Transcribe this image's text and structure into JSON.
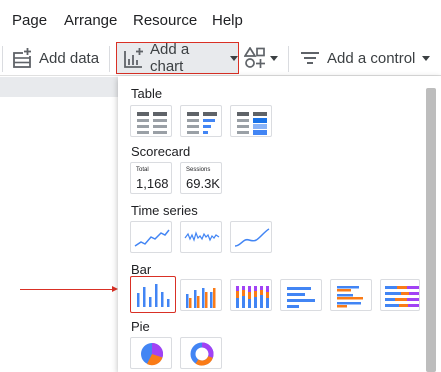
{
  "menu": {
    "items": [
      "Page",
      "Arrange",
      "Resource",
      "Help"
    ]
  },
  "toolbar": {
    "add_data_label": "Add data",
    "add_chart_label": "Add a chart",
    "add_control_label": "Add a control"
  },
  "chart_menu": {
    "sections": {
      "table": "Table",
      "scorecard": "Scorecard",
      "time_series": "Time series",
      "bar": "Bar",
      "pie": "Pie"
    },
    "scorecards": [
      {
        "label": "Total",
        "value": "1,168"
      },
      {
        "label": "Sessions",
        "value": "69.3K"
      }
    ],
    "selected": "bar-column-chart"
  },
  "colors": {
    "accent_blue": "#4285f4",
    "orange": "#fa7b17",
    "purple": "#a142f4",
    "red_highlight": "#d93025"
  }
}
